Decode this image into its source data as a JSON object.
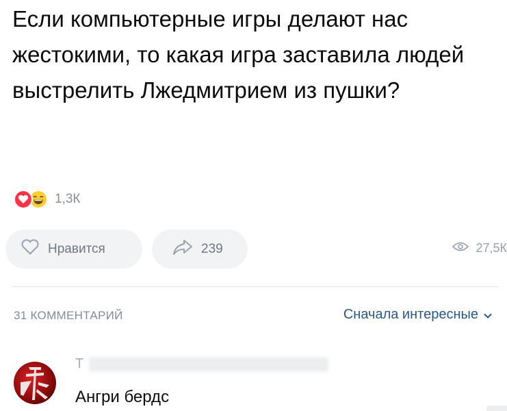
{
  "post": {
    "text": "Если компьютерные игры делают нас жестокими, то какая игра заставила людей выстрелить Лжедмитрием из пушки?"
  },
  "reactions": {
    "icons": [
      "heart-reaction-icon",
      "laughing-reaction-icon"
    ],
    "count": "1,3К"
  },
  "actions": {
    "like_label": "Нравится",
    "share_count": "239",
    "views_count": "27,5К"
  },
  "comments": {
    "count_label": "31 КОММЕНТАРИЙ",
    "sort_label": "Сначала интересные",
    "first": {
      "author_initial": "Т",
      "text": "Ангри бердс"
    }
  },
  "colors": {
    "accent": "#2a5885",
    "heart": "#ff3347",
    "laugh": "#ffcc33",
    "muted": "#818c99",
    "pill": "#f2f3f5"
  }
}
